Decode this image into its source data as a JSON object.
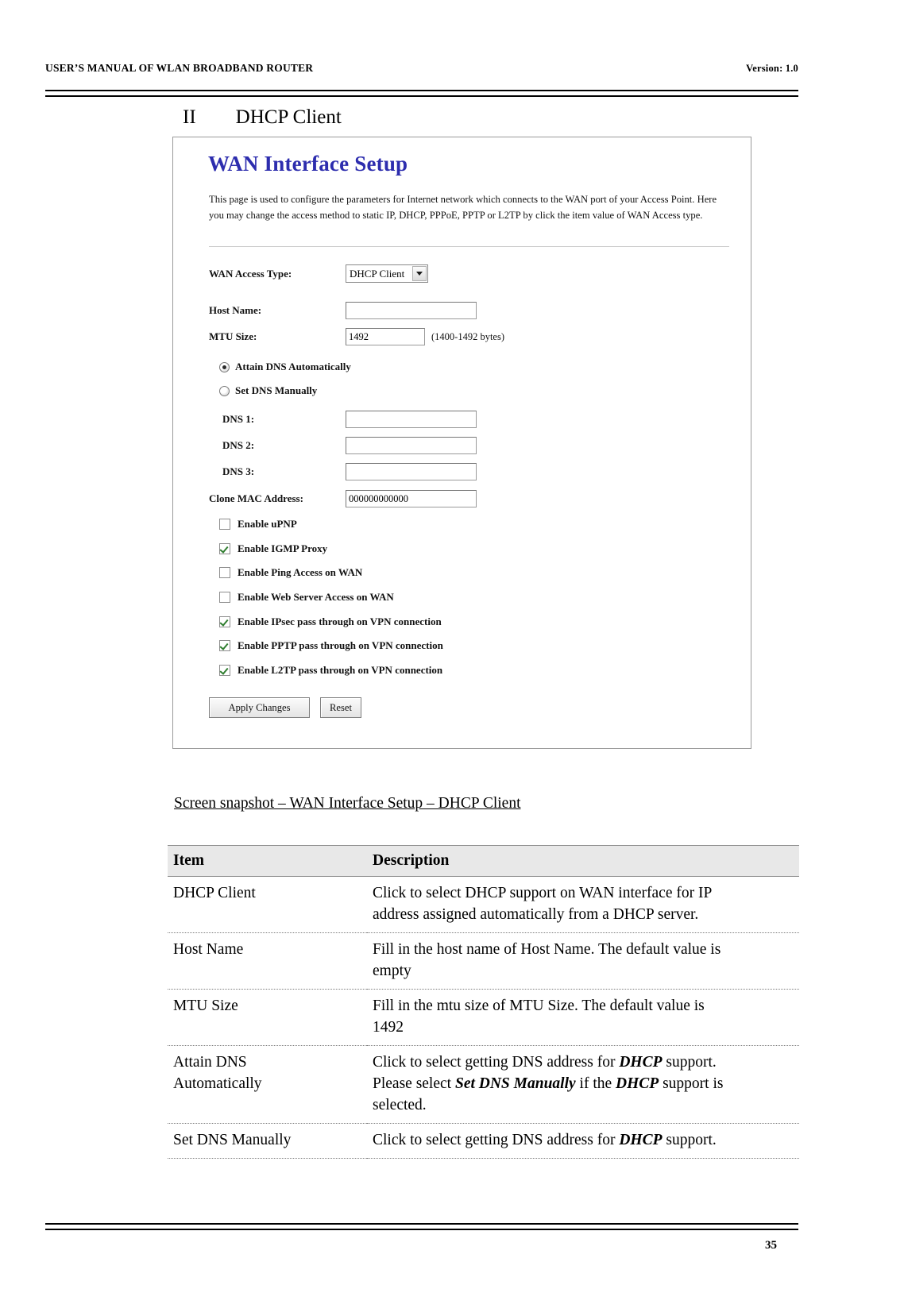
{
  "header": {
    "left": "USER’S MANUAL OF WLAN BROADBAND ROUTER",
    "right": "Version: 1.0"
  },
  "section": {
    "number": "II",
    "title": "DHCP Client"
  },
  "screenshot": {
    "title": "WAN Interface Setup",
    "intro": "This page is used to configure the parameters for Internet network which connects to the WAN port of your Access Point. Here you may change the access method to static IP, DHCP, PPPoE, PPTP or L2TP by click the item value of WAN Access type.",
    "fields": {
      "wan_access_type_label": "WAN Access Type:",
      "wan_access_type_value": "DHCP Client",
      "host_name_label": "Host Name:",
      "host_name_value": "",
      "mtu_size_label": "MTU Size:",
      "mtu_size_value": "1492",
      "mtu_hint": "(1400-1492 bytes)",
      "dns1_label": "DNS 1:",
      "dns1_value": "",
      "dns2_label": "DNS 2:",
      "dns2_value": "",
      "dns3_label": "DNS 3:",
      "dns3_value": "",
      "clone_mac_label": "Clone MAC Address:",
      "clone_mac_value": "000000000000"
    },
    "radios": [
      {
        "label": "Attain DNS Automatically",
        "checked": true
      },
      {
        "label": "Set DNS Manually",
        "checked": false
      }
    ],
    "checkboxes": [
      {
        "label": "Enable uPNP",
        "checked": false
      },
      {
        "label": "Enable IGMP Proxy",
        "checked": true
      },
      {
        "label": "Enable Ping Access on WAN",
        "checked": false
      },
      {
        "label": "Enable Web Server Access on WAN",
        "checked": false
      },
      {
        "label": "Enable IPsec pass through on VPN connection",
        "checked": true
      },
      {
        "label": "Enable PPTP pass through on VPN connection",
        "checked": true
      },
      {
        "label": "Enable L2TP pass through on VPN connection",
        "checked": true
      }
    ],
    "buttons": {
      "apply": "Apply Changes",
      "reset": "Reset"
    }
  },
  "caption": "Screen snapshot – WAN Interface Setup – DHCP Client",
  "table": {
    "headers": [
      "Item",
      "Description"
    ],
    "rows": [
      {
        "item": "DHCP Client",
        "desc_lines": [
          "Click to select DHCP support on WAN interface for IP",
          "address assigned automatically from a DHCP server."
        ]
      },
      {
        "item": "Host Name",
        "desc_lines": [
          "Fill in the host name of Host Name. The default value is",
          "empty"
        ]
      },
      {
        "item": "MTU Size",
        "desc_lines": [
          "Fill in the mtu size of MTU Size. The default value is",
          "1492"
        ]
      },
      {
        "item": "Attain DNS Automatically",
        "item_lines": [
          "Attain DNS",
          "Automatically"
        ],
        "desc_rich": [
          [
            {
              "t": "Click to select getting DNS address for "
            },
            {
              "t": "DHCP",
              "b": true
            },
            {
              "t": " support."
            }
          ],
          [
            {
              "t": "Please select "
            },
            {
              "t": "Set DNS Manually",
              "b": true
            },
            {
              "t": " if the "
            },
            {
              "t": "DHCP",
              "b": true
            },
            {
              "t": " support is"
            }
          ],
          [
            {
              "t": "selected."
            }
          ]
        ]
      },
      {
        "item": "Set DNS Manually",
        "desc_rich": [
          [
            {
              "t": "Click to select getting DNS address for "
            },
            {
              "t": "DHCP",
              "b": true
            },
            {
              "t": " support."
            }
          ]
        ]
      }
    ]
  },
  "footer": {
    "page_number": "35"
  }
}
